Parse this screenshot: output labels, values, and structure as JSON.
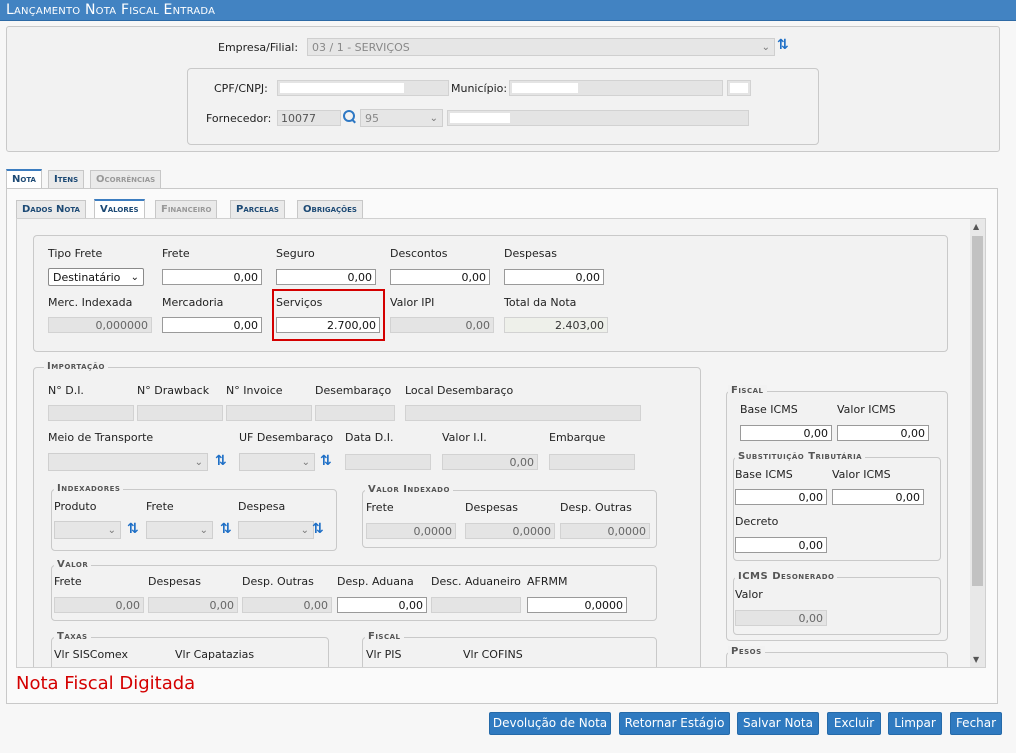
{
  "window": {
    "title": "Lançamento Nota Fiscal Entrada"
  },
  "header": {
    "empresa_label": "Empresa/Filial:",
    "empresa_value": "03 / 1 -                     SERVIÇOS",
    "cpf_label": "CPF/CNPJ:",
    "municipio_label": "Município:",
    "fornecedor_label": "Fornecedor:",
    "fornecedor_code": "10077",
    "fornecedor_sel": "95"
  },
  "tabs": [
    "Nota",
    "Itens",
    "Ocorrências"
  ],
  "subtabs": [
    "Dados Nota",
    "Valores",
    "Financeiro",
    "Parcelas",
    "Obrigações"
  ],
  "valores": {
    "tipo_frete_label": "Tipo Frete",
    "tipo_frete_value": "Destinatário",
    "frete_label": "Frete",
    "frete_value": "0,00",
    "seguro_label": "Seguro",
    "seguro_value": "0,00",
    "descontos_label": "Descontos",
    "descontos_value": "0,00",
    "despesas_label": "Despesas",
    "despesas_value": "0,00",
    "merc_label": "Merc. Indexada",
    "merc_value": "0,000000",
    "mercadoria_label": "Mercadoria",
    "mercadoria_value": "0,00",
    "servicos_label": "Serviços",
    "servicos_value": "2.700,00",
    "ipi_label": "Valor IPI",
    "ipi_value": "0,00",
    "total_label": "Total da Nota",
    "total_value": "2.403,00"
  },
  "importacao": {
    "title": "Importação",
    "nd_label": "N° D.I.",
    "drawback_label": "N° Drawback",
    "invoice_label": "N° Invoice",
    "desemb_label": "Desembaraço",
    "local_label": "Local Desembaraço",
    "meio_label": "Meio de Transporte",
    "uf_label": "UF Desembaraço",
    "data_label": "Data D.I.",
    "ii_label": "Valor I.I.",
    "ii_value": "0,00",
    "embarque_label": "Embarque",
    "indexadores_title": "Indexadores",
    "ind_produto": "Produto",
    "ind_frete": "Frete",
    "ind_despesa": "Despesa",
    "vi_title": "Valor Indexado",
    "vi_frete": "Frete",
    "vi_despesas": "Despesas",
    "vi_outras": "Desp. Outras",
    "vi_frete_value": "0,0000",
    "vi_despesas_value": "0,0000",
    "vi_outras_value": "0,0000",
    "valor_title": "Valor",
    "v_frete": "Frete",
    "v_despesas": "Despesas",
    "v_outras": "Desp. Outras",
    "v_aduana": "Desp. Aduana",
    "v_aduaneiro": "Desc. Aduaneiro",
    "v_afrmm": "AFRMM",
    "v_frete_value": "0,00",
    "v_despesas_value": "0,00",
    "v_outras_value": "0,00",
    "v_aduana_value": "0,00",
    "v_afrmm_value": "0,0000",
    "taxas_title": "Taxas",
    "siscomex": "Vlr SISComex",
    "capatazias": "Vlr Capatazias",
    "fiscal_title": "Fiscal",
    "pis": "Vlr PIS",
    "cofins": "Vlr COFINS"
  },
  "fiscal": {
    "title": "Fiscal",
    "base_icms": "Base ICMS",
    "valor_icms": "Valor ICMS",
    "base_value": "0,00",
    "valor_value": "0,00",
    "st_title": "Substituição Tributária",
    "st_base": "Base ICMS",
    "st_valor": "Valor ICMS",
    "st_base_value": "0,00",
    "st_valor_value": "0,00",
    "decreto": "Decreto",
    "decreto_value": "0,00",
    "des_title": "ICMS Desonerado",
    "des_valor": "Valor",
    "des_value": "0,00",
    "pesos_title": "Pesos"
  },
  "status": "Nota Fiscal Digitada",
  "buttons": [
    "Devolução de Nota",
    "Retornar Estágio",
    "Salvar Nota",
    "Excluir",
    "Limpar",
    "Fechar"
  ],
  "colors": {
    "accent": "#2f7ac0",
    "highlight": "#d40000"
  }
}
